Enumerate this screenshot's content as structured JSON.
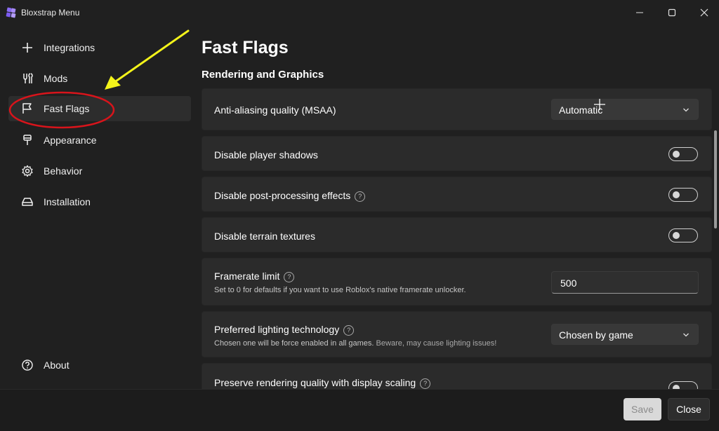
{
  "window": {
    "title": "Bloxstrap Menu",
    "accent_color": "#8b6cf6"
  },
  "sidebar": {
    "items": [
      {
        "label": "Integrations",
        "icon": "plus-icon"
      },
      {
        "label": "Mods",
        "icon": "tools-icon"
      },
      {
        "label": "Fast Flags",
        "icon": "flag-icon",
        "active": true
      },
      {
        "label": "Appearance",
        "icon": "paintbrush-icon"
      },
      {
        "label": "Behavior",
        "icon": "gear-icon"
      },
      {
        "label": "Installation",
        "icon": "drive-icon"
      }
    ],
    "about": {
      "label": "About",
      "icon": "question-icon"
    }
  },
  "main": {
    "page_title": "Fast Flags",
    "section_title": "Rendering and Graphics",
    "settings": {
      "msaa": {
        "label": "Anti-aliasing quality (MSAA)",
        "value": "Automatic"
      },
      "shadows": {
        "label": "Disable player shadows",
        "enabled": false
      },
      "postprocessing": {
        "label": "Disable post-processing effects",
        "enabled": false
      },
      "terrain": {
        "label": "Disable terrain textures",
        "enabled": false
      },
      "framerate": {
        "label": "Framerate limit",
        "description": "Set to 0 for defaults if you want to use Roblox's native framerate unlocker.",
        "value": "500"
      },
      "lighting": {
        "label": "Preferred lighting technology",
        "description": "Chosen one will be force enabled in all games.",
        "warning": "Beware, may cause lighting issues!",
        "value": "Chosen by game"
      },
      "scaling": {
        "label": "Preserve rendering quality with display scaling",
        "enabled": false
      }
    }
  },
  "footer": {
    "save_label": "Save",
    "close_label": "Close"
  },
  "annotation": {
    "arrow_color": "#f4f41a",
    "circle_color": "#d8141b"
  }
}
